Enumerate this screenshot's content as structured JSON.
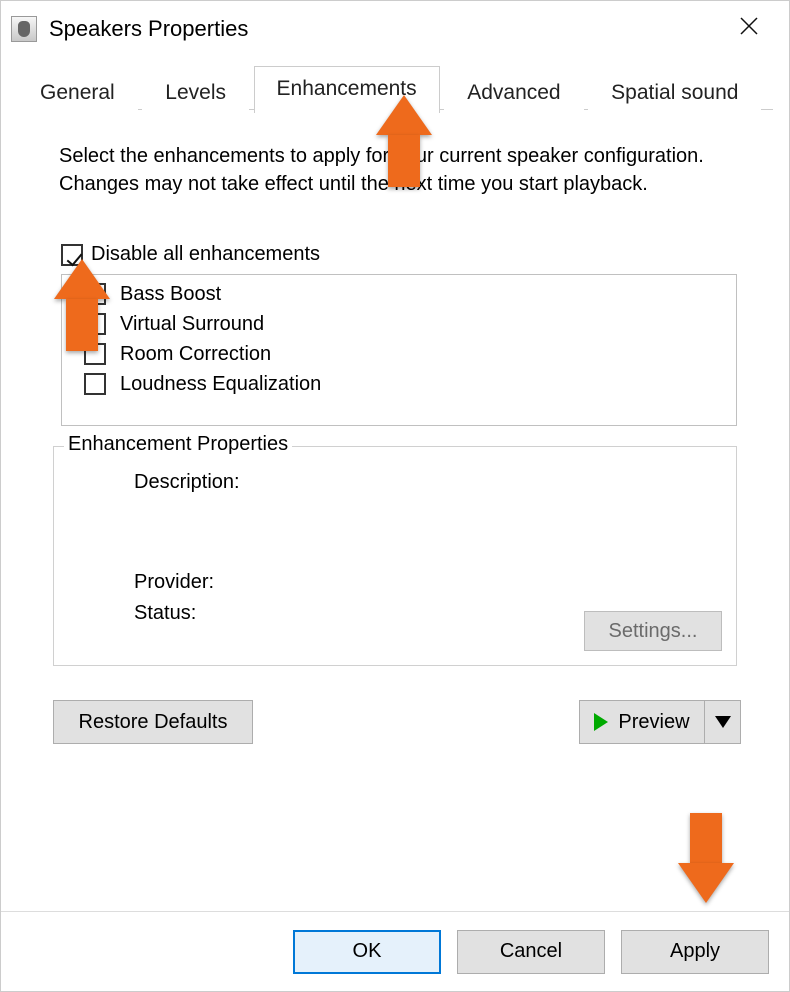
{
  "window": {
    "title": "Speakers Properties"
  },
  "tabs": {
    "general": "General",
    "levels": "Levels",
    "enhancements": "Enhancements",
    "advanced": "Advanced",
    "spatial": "Spatial sound",
    "active": "Enhancements"
  },
  "panel": {
    "instructions": "Select the enhancements to apply for your current speaker configuration. Changes may not take effect until the next time you start playback.",
    "disable_all_label": "Disable all enhancements",
    "disable_all_checked": true,
    "items": [
      {
        "label": "Bass Boost",
        "checked": false
      },
      {
        "label": "Virtual Surround",
        "checked": false
      },
      {
        "label": "Room Correction",
        "checked": false
      },
      {
        "label": "Loudness Equalization",
        "checked": false
      }
    ],
    "group_title": "Enhancement Properties",
    "description_label": "Description:",
    "provider_label": "Provider:",
    "status_label": "Status:",
    "settings_label": "Settings...",
    "restore_label": "Restore Defaults",
    "preview_label": "Preview"
  },
  "buttons": {
    "ok": "OK",
    "cancel": "Cancel",
    "apply": "Apply"
  }
}
